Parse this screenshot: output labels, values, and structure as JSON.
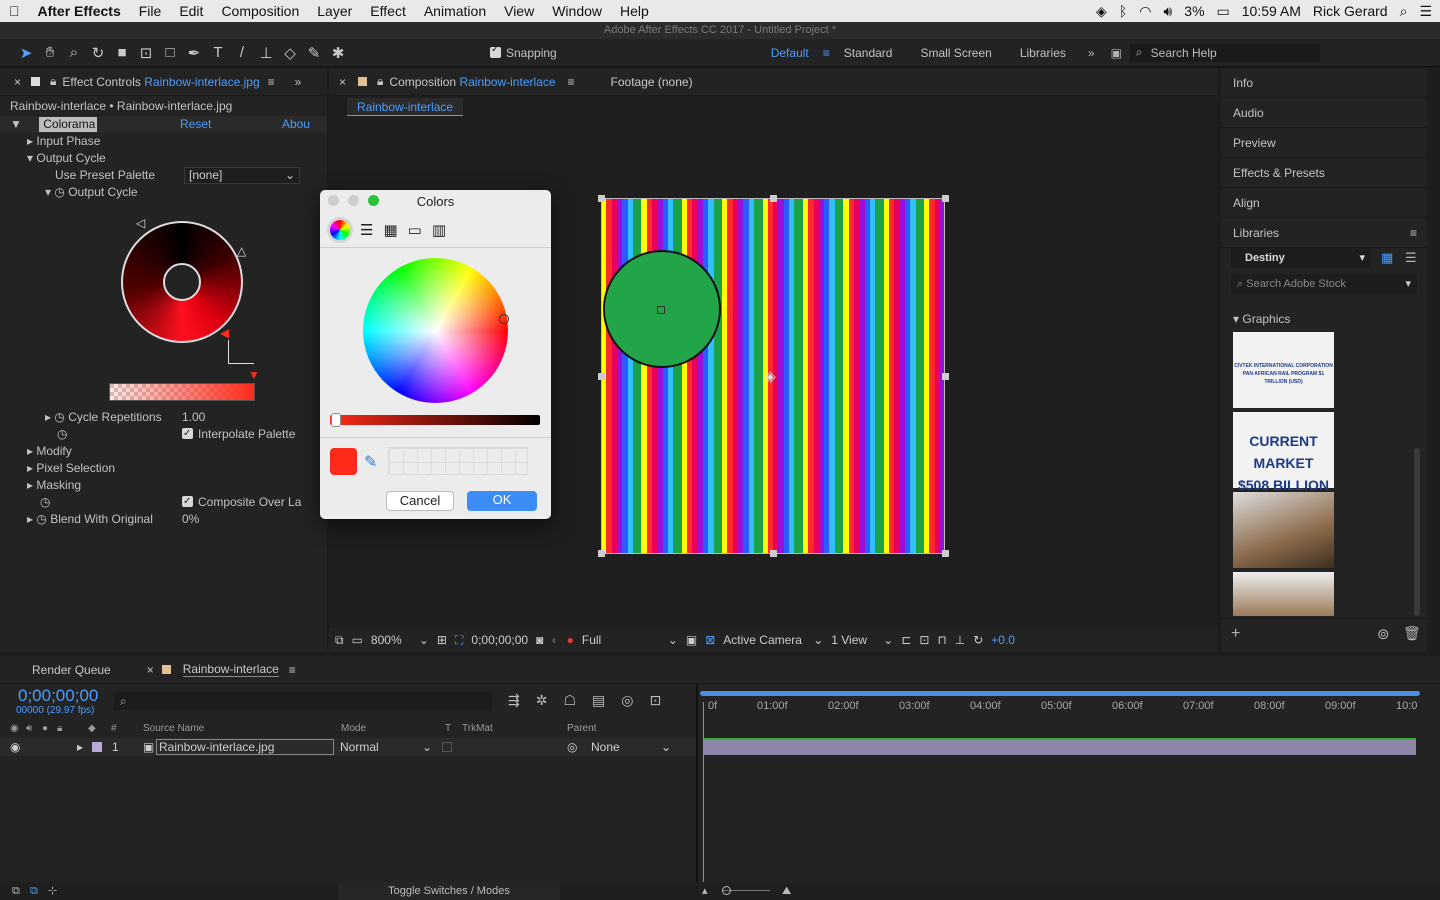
{
  "menubar": {
    "app_name": "After Effects",
    "items": [
      "File",
      "Edit",
      "Composition",
      "Layer",
      "Effect",
      "Animation",
      "View",
      "Window",
      "Help"
    ],
    "battery": "3%",
    "time": "10:59 AM",
    "user": "Rick Gerard"
  },
  "window_title": "Adobe After Effects CC 2017 - Untitled Project *",
  "toolbar": {
    "snapping_label": "Snapping",
    "workspaces": [
      "Default",
      "Standard",
      "Small Screen",
      "Libraries"
    ],
    "search_help": "Search Help"
  },
  "effect_controls": {
    "tab_label": "Effect Controls",
    "tab_file": "Rainbow-interlace.jpg",
    "breadcrumb": "Rainbow-interlace • Rainbow-interlace.jpg",
    "effect_name": "Colorama",
    "reset": "Reset",
    "about": "Abou",
    "input_phase": "Input Phase",
    "output_cycle_group": "Output Cycle",
    "use_preset_palette": "Use Preset Palette",
    "preset_value": "[none]",
    "output_cycle": "Output Cycle",
    "cycle_repetitions": "Cycle Repetitions",
    "cycle_repetitions_value": "1.00",
    "interpolate_palette": "Interpolate Palette",
    "modify": "Modify",
    "pixel_selection": "Pixel Selection",
    "masking": "Masking",
    "composite_over": "Composite Over La",
    "blend_with_original": "Blend With Original",
    "blend_value": "0%"
  },
  "colors_dialog": {
    "title": "Colors",
    "cancel": "Cancel",
    "ok": "OK",
    "selected_color": "#ff2a1a"
  },
  "composition": {
    "tab_label": "Composition",
    "tab_comp": "Rainbow-interlace",
    "footage_tab": "Footage (none)",
    "sub_tab": "Rainbow-interlace",
    "stripe_colors": [
      "#ffff00",
      "#ff2a2a",
      "#e8005a",
      "#9b10d8",
      "#2c5cff",
      "#30c0ff",
      "#1aa14a"
    ],
    "circle_color": "#22a449"
  },
  "viewer_bar": {
    "zoom": "800%",
    "timecode": "0;00;00;00",
    "resolution": "Full",
    "camera": "Active Camera",
    "views": "1 View",
    "exposure": "+0.0"
  },
  "right_panels": {
    "items": [
      "Info",
      "Audio",
      "Preview",
      "Effects & Presets",
      "Align",
      "Libraries"
    ],
    "library_name": "Destiny",
    "stock_search": "Search Adobe Stock",
    "graphics_label": "Graphics",
    "thumb1_line1": "CIVTEK INTERNATIONAL CORPORATION",
    "thumb1_line2": "PAN AFRICAN RAIL PROGRAM $1 TRILLION (USD)",
    "thumb2_line1": "CURRENT MARKET",
    "thumb2_line2": "$508 BILLION"
  },
  "timeline": {
    "render_queue": "Render Queue",
    "comp_tab": "Rainbow-interlace",
    "timecode": "0;00;00;00",
    "fps": "00000 (29.97 fps)",
    "headers": {
      "num": "#",
      "source": "Source Name",
      "mode": "Mode",
      "t": "T",
      "trkmat": "TrkMat",
      "parent": "Parent"
    },
    "layer": {
      "index": "1",
      "name": "Rainbow-interlace.jpg",
      "mode": "Normal",
      "parent": "None"
    },
    "ticks": [
      "0f",
      "01:00f",
      "02:00f",
      "03:00f",
      "04:00f",
      "05:00f",
      "06:00f",
      "07:00f",
      "08:00f",
      "09:00f",
      "10:0"
    ],
    "toggle_label": "Toggle Switches / Modes"
  }
}
